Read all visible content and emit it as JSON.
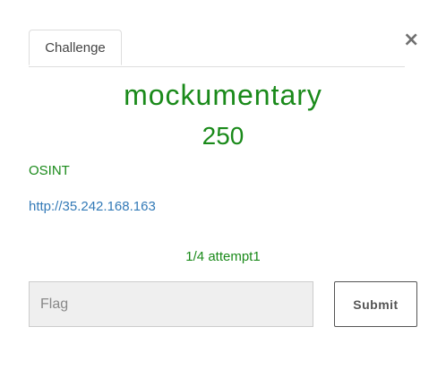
{
  "modal": {
    "close_symbol": "×"
  },
  "tabs": [
    {
      "label": "Challenge",
      "active": true
    }
  ],
  "challenge": {
    "name": "mockumentary",
    "points": "250",
    "category": "OSINT",
    "link": "http://35.242.168.163",
    "attempts": "1/4 attempt1"
  },
  "form": {
    "flag_placeholder": "Flag",
    "flag_value": "",
    "submit_label": "Submit"
  },
  "colors": {
    "accent_green": "#1a8a1a",
    "link_blue": "#337ab7"
  },
  "icons": {
    "close": "close-icon"
  }
}
